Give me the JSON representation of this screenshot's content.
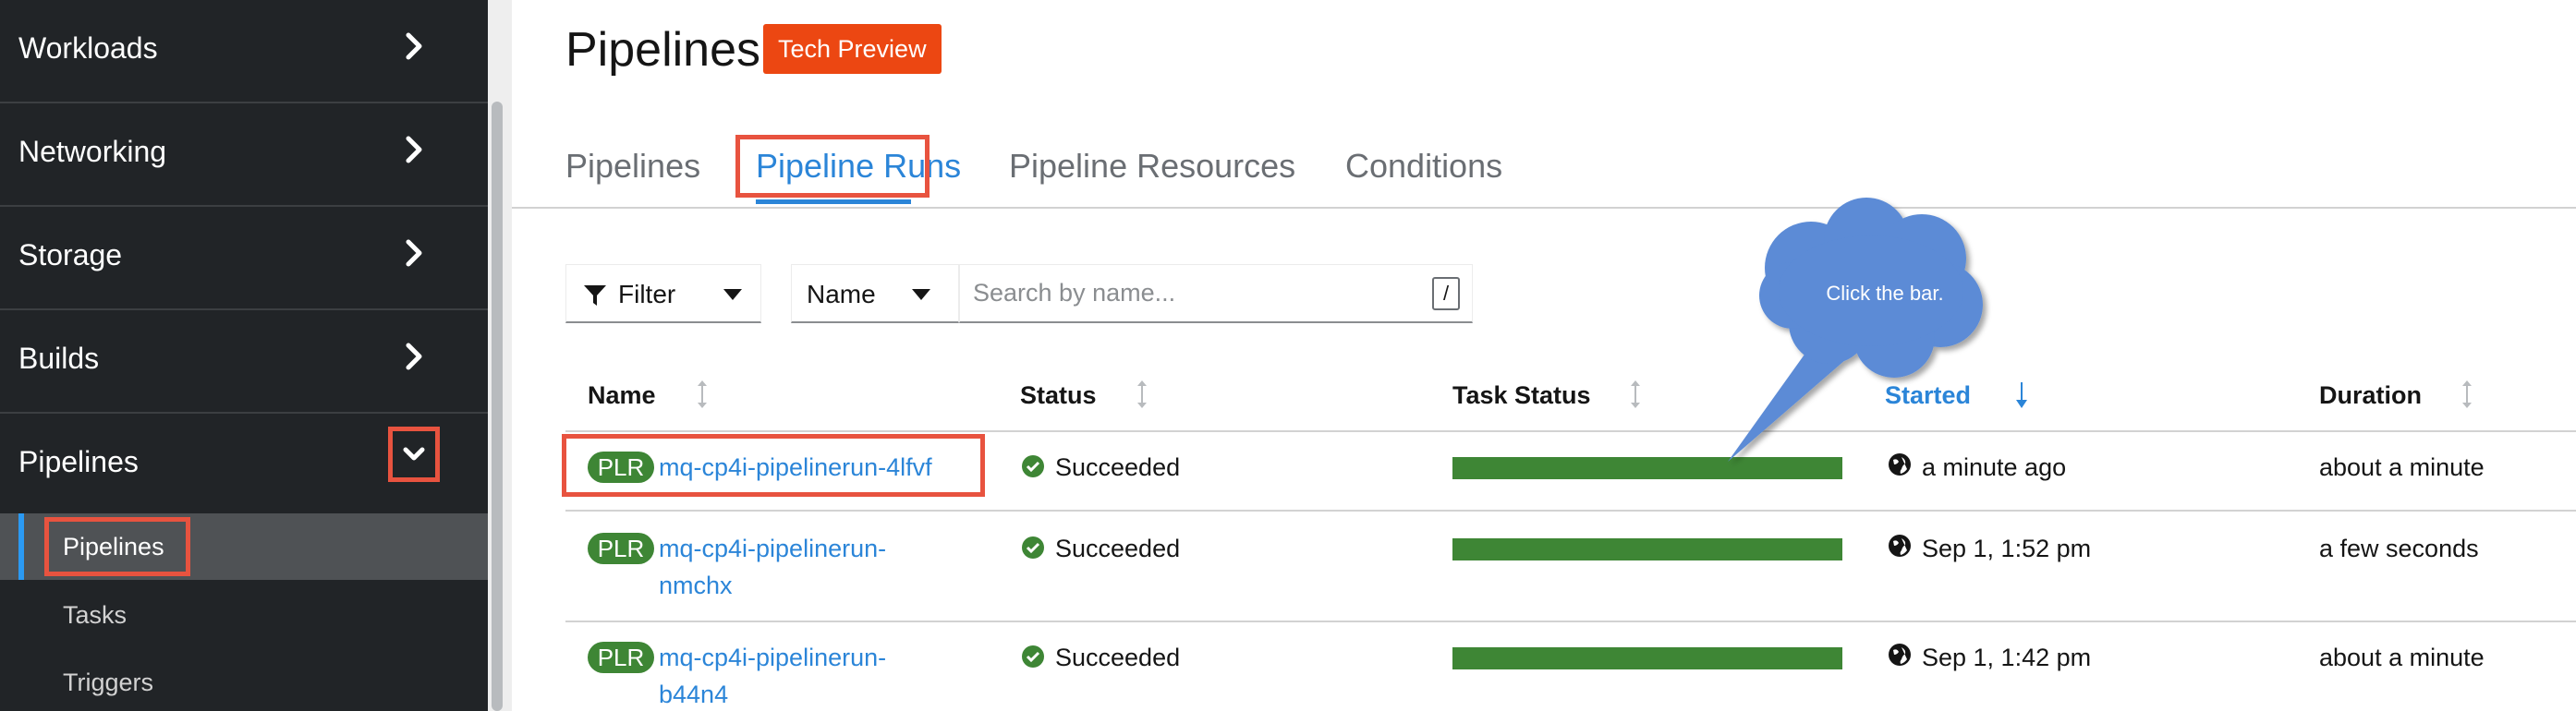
{
  "sidebar": {
    "items": [
      {
        "label": "Workloads"
      },
      {
        "label": "Networking"
      },
      {
        "label": "Storage"
      },
      {
        "label": "Builds"
      },
      {
        "label": "Pipelines"
      }
    ],
    "sub_items": [
      {
        "label": "Pipelines"
      },
      {
        "label": "Tasks"
      },
      {
        "label": "Triggers"
      }
    ]
  },
  "header": {
    "title": "Pipelines",
    "badge": "Tech Preview"
  },
  "tabs": [
    {
      "label": "Pipelines"
    },
    {
      "label": "Pipeline Runs"
    },
    {
      "label": "Pipeline Resources"
    },
    {
      "label": "Conditions"
    }
  ],
  "toolbar": {
    "filter_label": "Filter",
    "name_select": "Name",
    "search_placeholder": "Search by name...",
    "shortcut_key": "/"
  },
  "table": {
    "columns": [
      "Name",
      "Status",
      "Task Status",
      "Started",
      "Duration"
    ],
    "rows": [
      {
        "badge": "PLR",
        "name": "mq-cp4i-pipelinerun-4lfvf",
        "status": "Succeeded",
        "task_progress": 1.0,
        "started": "a minute ago",
        "duration": "about a minute"
      },
      {
        "badge": "PLR",
        "name": "mq-cp4i-pipelinerun-nmchx",
        "status": "Succeeded",
        "task_progress": 1.0,
        "started": "Sep 1, 1:52 pm",
        "duration": "a few seconds"
      },
      {
        "badge": "PLR",
        "name": "mq-cp4i-pipelinerun-b44n4",
        "status": "Succeeded",
        "task_progress": 1.0,
        "started": "Sep 1, 1:42 pm",
        "duration": "about a minute"
      }
    ]
  },
  "callout": {
    "text": "Click the bar."
  },
  "colors": {
    "sidebar_bg": "#212427",
    "accent": "#2b85d8",
    "badge": "#ec4712",
    "success": "#3e8635",
    "highlight": "#e8533f",
    "callout": "#5b8bd6"
  }
}
